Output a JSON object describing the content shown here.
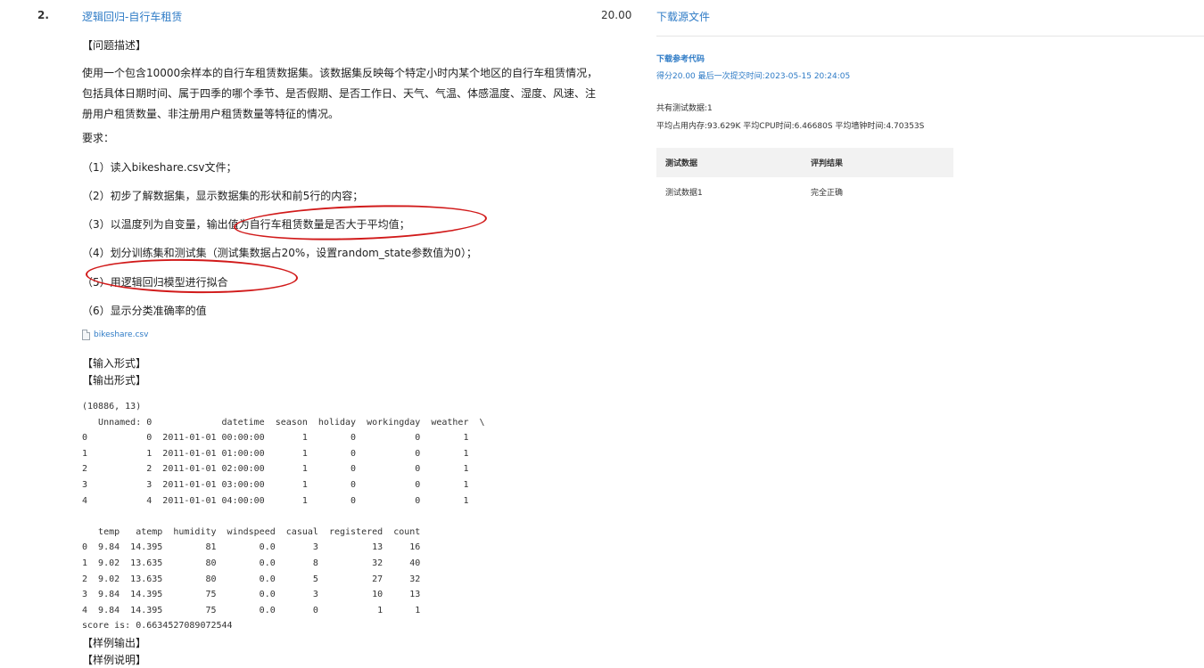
{
  "question": {
    "number": "2.",
    "title": "逻辑回归-自行车租赁",
    "score": "20.00"
  },
  "problem": {
    "desc_header": "【问题描述】",
    "desc_text": "使用一个包含10000余样本的自行车租赁数据集。该数据集反映每个特定小时内某个地区的自行车租赁情况，包括具体日期时间、属于四季的哪个季节、是否假期、是否工作日、天气、气温、体感温度、湿度、风速、注册用户租赁数量、非注册用户租赁数量等特征的情况。",
    "requirements_label": "要求：",
    "requirements": [
      "（1）读入bikeshare.csv文件；",
      "（2）初步了解数据集，显示数据集的形状和前5行的内容；",
      "（3）以温度列为自变量，输出值为自行车租赁数量是否大于平均值；",
      "（4）划分训练集和测试集（测试集数据占20%，设置random_state参数值为0）；",
      "（5）用逻辑回归模型进行拟合",
      "（6）显示分类准确率的值"
    ],
    "attachment": "bikeshare.csv",
    "input_header": "【输入形式】",
    "output_header": "【输出形式】",
    "output_text": "(10886, 13)\n   Unnamed: 0             datetime  season  holiday  workingday  weather  \\\n0           0  2011-01-01 00:00:00       1        0           0        1\n1           1  2011-01-01 01:00:00       1        0           0        1\n2           2  2011-01-01 02:00:00       1        0           0        1\n3           3  2011-01-01 03:00:00       1        0           0        1\n4           4  2011-01-01 04:00:00       1        0           0        1\n\n   temp   atemp  humidity  windspeed  casual  registered  count\n0  9.84  14.395        81        0.0       3          13     16\n1  9.02  13.635        80        0.0       8          32     40\n2  9.02  13.635        80        0.0       5          27     32\n3  9.84  14.395        75        0.0       3          10     13\n4  9.84  14.395        75        0.0       0           1      1\nscore is: 0.6634527089072544",
    "sample_output_header": "【样例输出】",
    "sample_desc_header": "【样例说明】"
  },
  "sidebar": {
    "download_source": "下载源文件",
    "download_ref": "下载参考代码",
    "score_line": "得分20.00   最后一次提交时间:2023-05-15 20:24:05",
    "tests_count": "共有测试数据:1",
    "avg_line": "平均占用内存:93.629K    平均CPU时间:6.46680S    平均墙钟时间:4.70353S",
    "table": {
      "headers": [
        "测试数据",
        "评判结果"
      ],
      "rows": [
        [
          "测试数据1",
          "完全正确"
        ]
      ]
    }
  },
  "colors": {
    "link": "#2e7bc6",
    "annotation": "#d11a1a"
  }
}
